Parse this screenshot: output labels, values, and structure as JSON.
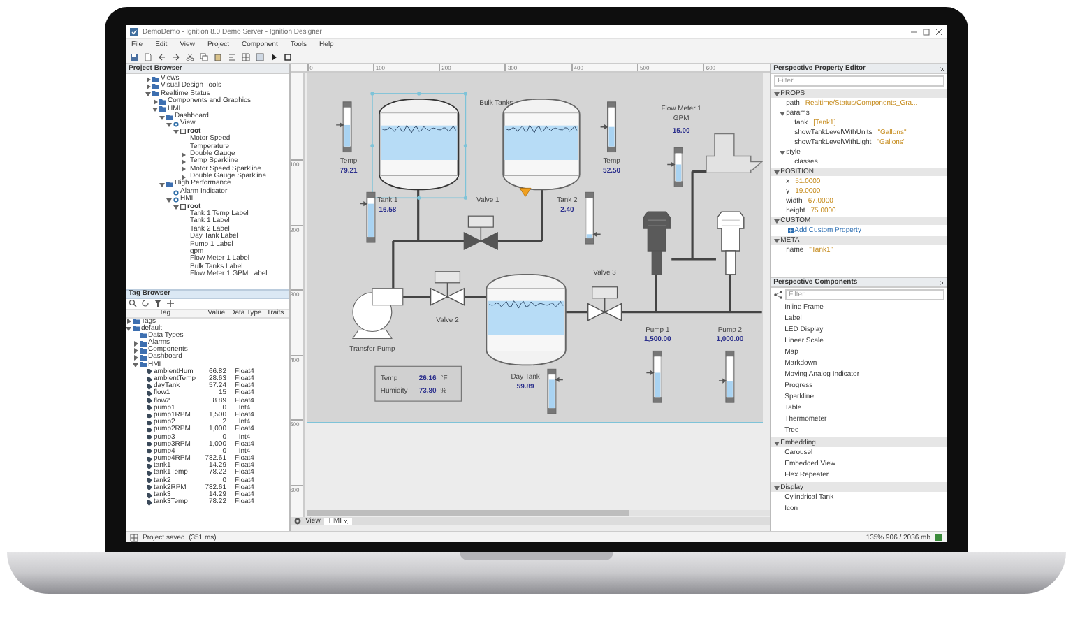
{
  "window": {
    "title": "DemoDemo - Ignition 8.0 Demo Server - Ignition Designer"
  },
  "menu": [
    "File",
    "Edit",
    "View",
    "Project",
    "Component",
    "Tools",
    "Help"
  ],
  "project_browser": {
    "title": "Project Browser",
    "tree": [
      {
        "label": "Views",
        "kind": "folder",
        "expanded": false
      },
      {
        "label": "Visual Design Tools",
        "kind": "folder",
        "expanded": false
      },
      {
        "label": "Realtime Status",
        "kind": "folder",
        "expanded": true,
        "children": [
          {
            "label": "Components and Graphics",
            "kind": "folder",
            "expanded": false
          },
          {
            "label": "HMI",
            "kind": "folder",
            "expanded": true,
            "children": [
              {
                "label": "Dashboard",
                "kind": "folder",
                "expanded": true,
                "children": [
                  {
                    "label": "View",
                    "kind": "view",
                    "expanded": true,
                    "children": [
                      {
                        "label": "root",
                        "kind": "container",
                        "expanded": true,
                        "children": [
                          {
                            "label": "Motor Speed",
                            "kind": "component"
                          },
                          {
                            "label": "Temperature",
                            "kind": "component"
                          },
                          {
                            "label": "Double Gauge",
                            "kind": "component",
                            "expanded": false
                          },
                          {
                            "label": "Temp Sparkline",
                            "kind": "component",
                            "expanded": false
                          },
                          {
                            "label": "Motor Speed Sparkline",
                            "kind": "component",
                            "expanded": false
                          },
                          {
                            "label": "Double Gauge Sparkline",
                            "kind": "component",
                            "expanded": false
                          }
                        ]
                      }
                    ]
                  }
                ]
              },
              {
                "label": "High Performance",
                "kind": "folder",
                "expanded": true,
                "children": [
                  {
                    "label": "Alarm Indicator",
                    "kind": "view"
                  },
                  {
                    "label": "HMI",
                    "kind": "view",
                    "expanded": true,
                    "children": [
                      {
                        "label": "root",
                        "kind": "container",
                        "expanded": true,
                        "children": [
                          {
                            "label": "Tank 1 Temp Label",
                            "kind": "component"
                          },
                          {
                            "label": "Tank 1 Label",
                            "kind": "component"
                          },
                          {
                            "label": "Tank 2 Label",
                            "kind": "component"
                          },
                          {
                            "label": "Day Tank Label",
                            "kind": "component"
                          },
                          {
                            "label": "Pump 1 Label",
                            "kind": "component"
                          },
                          {
                            "label": "gpm",
                            "kind": "component"
                          },
                          {
                            "label": "Flow Meter 1 Label",
                            "kind": "component"
                          },
                          {
                            "label": "Bulk Tanks Label",
                            "kind": "component"
                          },
                          {
                            "label": "Flow Meter 1 GPM Label",
                            "kind": "component"
                          }
                        ]
                      }
                    ]
                  }
                ]
              }
            ]
          }
        ]
      }
    ]
  },
  "tag_browser": {
    "title": "Tag Browser",
    "columns": [
      "Tag",
      "Value",
      "Data Type",
      "Traits"
    ],
    "tree": [
      {
        "label": "Tags",
        "kind": "folder",
        "expanded": false
      },
      {
        "label": "default",
        "kind": "folder",
        "expanded": true,
        "children": [
          {
            "label": "Data Types",
            "kind": "folder"
          },
          {
            "label": "Alarms",
            "kind": "folder",
            "expanded": false
          },
          {
            "label": "Components",
            "kind": "folder",
            "expanded": false
          },
          {
            "label": "Dashboard",
            "kind": "folder",
            "expanded": false
          },
          {
            "label": "HMI",
            "kind": "folder",
            "expanded": true,
            "children": [
              {
                "label": "ambientHum",
                "kind": "tag",
                "value": "66.82",
                "type": "Float4"
              },
              {
                "label": "ambientTemp",
                "kind": "tag",
                "value": "28.63",
                "type": "Float4"
              },
              {
                "label": "dayTank",
                "kind": "tag",
                "value": "57.24",
                "type": "Float4"
              },
              {
                "label": "flow1",
                "kind": "tag",
                "value": "15",
                "type": "Float4"
              },
              {
                "label": "flow2",
                "kind": "tag",
                "value": "8.89",
                "type": "Float4"
              },
              {
                "label": "pump1",
                "kind": "tag",
                "value": "0",
                "type": "Int4"
              },
              {
                "label": "pump1RPM",
                "kind": "tag",
                "value": "1,500",
                "type": "Float4"
              },
              {
                "label": "pump2",
                "kind": "tag",
                "value": "2",
                "type": "Int4"
              },
              {
                "label": "pump2RPM",
                "kind": "tag",
                "value": "1,000",
                "type": "Float4"
              },
              {
                "label": "pump3",
                "kind": "tag",
                "value": "0",
                "type": "Int4"
              },
              {
                "label": "pump3RPM",
                "kind": "tag",
                "value": "1,000",
                "type": "Float4"
              },
              {
                "label": "pump4",
                "kind": "tag",
                "value": "0",
                "type": "Int4"
              },
              {
                "label": "pump4RPM",
                "kind": "tag",
                "value": "782.61",
                "type": "Float4"
              },
              {
                "label": "tank1",
                "kind": "tag",
                "value": "14.29",
                "type": "Float4"
              },
              {
                "label": "tank1Temp",
                "kind": "tag",
                "value": "78.22",
                "type": "Float4"
              },
              {
                "label": "tank2",
                "kind": "tag",
                "value": "0",
                "type": "Float4"
              },
              {
                "label": "tank2RPM",
                "kind": "tag",
                "value": "782.61",
                "type": "Float4"
              },
              {
                "label": "tank3",
                "kind": "tag",
                "value": "14.29",
                "type": "Float4"
              },
              {
                "label": "tank3Temp",
                "kind": "tag",
                "value": "78.22",
                "type": "Float4"
              }
            ]
          }
        ]
      }
    ]
  },
  "ruler": {
    "x_labels": [
      "0",
      "100",
      "200",
      "300",
      "400",
      "500",
      "600"
    ],
    "y_labels": [
      "100",
      "200",
      "300",
      "400",
      "500",
      "600"
    ]
  },
  "diagram": {
    "group_label": "Bulk Tanks",
    "tanks": [
      {
        "name": "Tank 1",
        "value": "16.58",
        "selected": true,
        "gauge": {
          "level": 0.85
        }
      },
      {
        "name": "Tank 2",
        "value": "2.40",
        "selected": false,
        "gauge": {
          "level": 0.1
        }
      },
      {
        "name": "Day Tank",
        "value": "59.89",
        "selected": false,
        "gauge": {
          "level": 0.85
        }
      }
    ],
    "temps": [
      {
        "label": "Temp",
        "value": "79.21",
        "level": 0.55
      },
      {
        "label": "Temp",
        "value": "52.50",
        "level": 0.5
      }
    ],
    "flow_meter": {
      "lines": [
        "Flow Meter 1",
        "GPM"
      ],
      "value": "15.00",
      "level": 0.6
    },
    "valves": [
      {
        "label": "Valve 1",
        "open": false
      },
      {
        "label": "Valve 2",
        "open": true
      },
      {
        "label": "Valve 3",
        "open": true
      }
    ],
    "transfer_pump": {
      "label": "Transfer Pump"
    },
    "pumps": [
      {
        "label": "Pump 1",
        "value": "1,500.00",
        "on": true,
        "gauge": {
          "level": 0.6
        }
      },
      {
        "label": "Pump 2",
        "value": "1,000.00",
        "on": false,
        "gauge": {
          "level": 0.4
        }
      }
    ],
    "ambient": [
      {
        "label": "Temp",
        "value": "26.16",
        "unit": "°F"
      },
      {
        "label": "Humidity",
        "value": "73.80",
        "unit": "%"
      }
    ]
  },
  "view_tabs": {
    "label": "View",
    "tabs": [
      {
        "label": "HMI",
        "selected": true
      }
    ]
  },
  "property_editor": {
    "title": "Perspective Property Editor",
    "filter_placeholder": "Filter",
    "sections": [
      {
        "label": "PROPS",
        "expanded": true,
        "rows": [
          {
            "key": "path",
            "value": "Realtime/Status/Components_Gra..."
          },
          {
            "key": "params",
            "expanded": true,
            "children": [
              {
                "key": "tank",
                "value": "[Tank1]"
              },
              {
                "key": "showTankLevelWithUnits",
                "value": "\"Gallons\""
              },
              {
                "key": "showTankLevelWithLight",
                "value": "\"Gallons\""
              }
            ]
          },
          {
            "key": "style",
            "expanded": true,
            "children": [
              {
                "key": "classes",
                "value": "..."
              }
            ]
          }
        ]
      },
      {
        "label": "POSITION",
        "expanded": true,
        "rows": [
          {
            "key": "x",
            "value": "51.0000"
          },
          {
            "key": "y",
            "value": "19.0000"
          },
          {
            "key": "width",
            "value": "67.0000"
          },
          {
            "key": "height",
            "value": "75.0000"
          }
        ]
      },
      {
        "label": "CUSTOM",
        "expanded": true,
        "rows": [
          {
            "kind": "add",
            "value": "Add Custom Property"
          }
        ]
      },
      {
        "label": "META",
        "expanded": true,
        "rows": [
          {
            "key": "name",
            "value": "\"Tank1\""
          }
        ]
      }
    ]
  },
  "components": {
    "title": "Perspective Components",
    "filter_placeholder": "Filter",
    "items": [
      "Inline Frame",
      "Label",
      "LED Display",
      "Linear Scale",
      "Map",
      "Markdown",
      "Moving Analog Indicator",
      "Progress",
      "Sparkline",
      "Table",
      "Thermometer",
      "Tree"
    ],
    "groups": [
      {
        "label": "Embedding",
        "expanded": true,
        "items": [
          "Carousel",
          "Embedded View",
          "Flex Repeater"
        ]
      },
      {
        "label": "Display",
        "expanded": true,
        "items": [
          "Cylindrical Tank",
          "Icon"
        ]
      }
    ]
  },
  "status_bar": {
    "message": "Project saved. (351 ms)",
    "memory": "135% 906 / 2036 mb"
  }
}
